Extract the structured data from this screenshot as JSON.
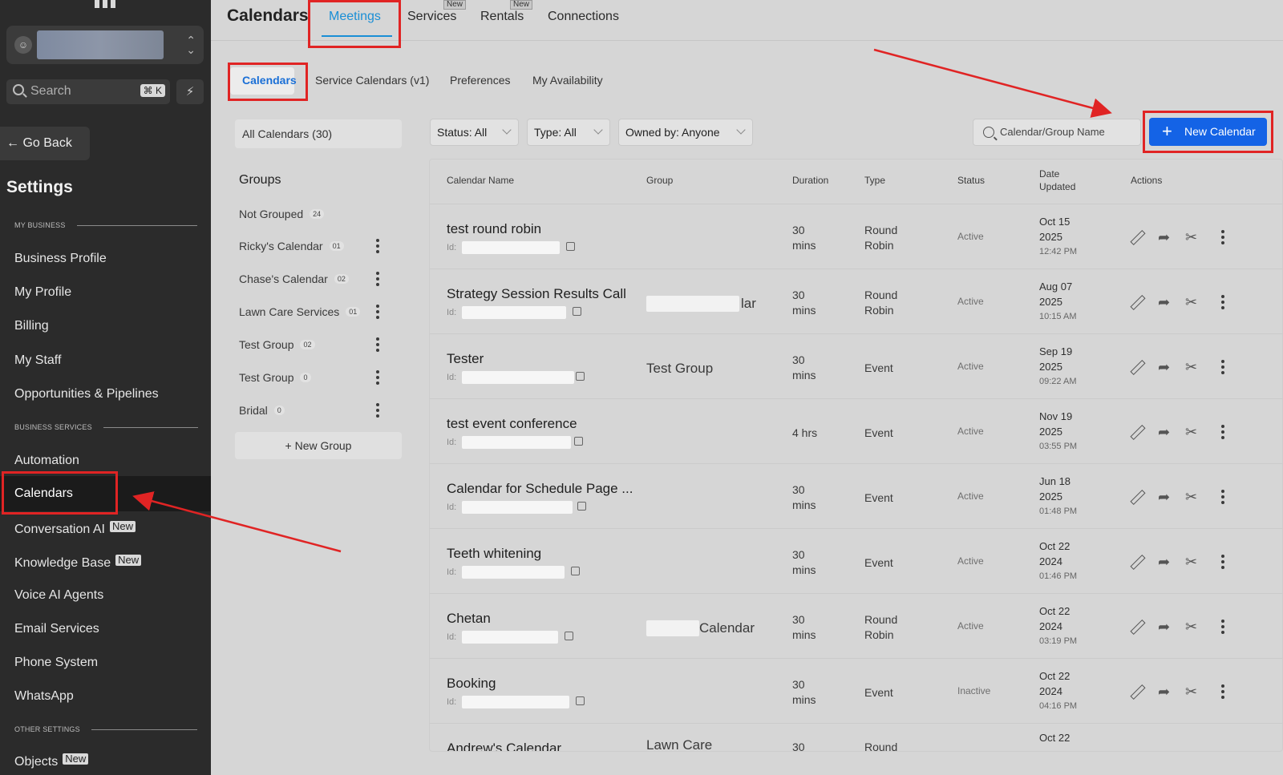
{
  "sidebar": {
    "search_label": "Search",
    "search_kbd": "⌘ K",
    "go_back": "Go Back",
    "settings_title": "Settings",
    "section_my_business": "MY BUSINESS",
    "section_business_services": "BUSINESS SERVICES",
    "section_other_settings": "OTHER SETTINGS",
    "items": {
      "business_profile": "Business Profile",
      "my_profile": "My Profile",
      "billing": "Billing",
      "my_staff": "My Staff",
      "opportunities": "Opportunities & Pipelines",
      "automation": "Automation",
      "calendars": "Calendars",
      "conversation_ai": "Conversation AI",
      "knowledge_base": "Knowledge Base",
      "voice_ai": "Voice AI Agents",
      "email_services": "Email Services",
      "phone_system": "Phone System",
      "whatsapp": "WhatsApp",
      "objects": "Objects"
    },
    "new_badge": "New"
  },
  "header": {
    "title": "Calendars",
    "tabs": {
      "meetings": "Meetings",
      "services": "Services",
      "rentals": "Rentals",
      "connections": "Connections"
    },
    "new_tag": "New"
  },
  "subtabs": {
    "calendars": "Calendars",
    "service_calendars": "Service Calendars (v1)",
    "preferences": "Preferences",
    "my_availability": "My Availability"
  },
  "groups_panel": {
    "all_calendars": "All Calendars (30)",
    "title": "Groups",
    "new_group": "New Group",
    "groups": [
      {
        "name": "Not Grouped",
        "count": "24"
      },
      {
        "name": "Ricky's Calendar",
        "count": "01"
      },
      {
        "name": "Chase's Calendar",
        "count": "02"
      },
      {
        "name": "Lawn Care Services",
        "count": "01"
      },
      {
        "name": "Test Group",
        "count": "02"
      },
      {
        "name": "Test Group",
        "count": "0"
      },
      {
        "name": "Bridal",
        "count": "0"
      }
    ]
  },
  "filters": {
    "status": "Status: All",
    "type": "Type: All",
    "owned_by": "Owned by: Anyone",
    "search_placeholder": "Calendar/Group Name",
    "new_calendar": "New Calendar"
  },
  "table": {
    "headers": {
      "name": "Calendar Name",
      "group": "Group",
      "duration": "Duration",
      "type": "Type",
      "status": "Status",
      "date_line1": "Date",
      "date_line2": "Updated",
      "actions": "Actions"
    },
    "id_label": "Id:",
    "rows": [
      {
        "name": "test round robin",
        "group": "",
        "dur1": "30",
        "dur2": "mins",
        "type1": "Round",
        "type2": "Robin",
        "status": "Active",
        "date1": "Oct 15",
        "date2": "2025",
        "time": "12:42 PM"
      },
      {
        "name": "Strategy Session Results Call",
        "group": "lar",
        "dur1": "30",
        "dur2": "mins",
        "type1": "Round",
        "type2": "Robin",
        "status": "Active",
        "date1": "Aug 07",
        "date2": "2025",
        "time": "10:15 AM"
      },
      {
        "name": "Tester",
        "group": "Test Group",
        "dur1": "30",
        "dur2": "mins",
        "type1": "Event",
        "type2": "",
        "status": "Active",
        "date1": "Sep 19",
        "date2": "2025",
        "time": "09:22 AM"
      },
      {
        "name": "test event conference",
        "group": "",
        "dur1": "4 hrs",
        "dur2": "",
        "type1": "Event",
        "type2": "",
        "status": "Active",
        "date1": "Nov 19",
        "date2": "2025",
        "time": "03:55 PM"
      },
      {
        "name": "Calendar for Schedule Page ...",
        "group": "",
        "dur1": "30",
        "dur2": "mins",
        "type1": "Event",
        "type2": "",
        "status": "Active",
        "date1": "Jun 18",
        "date2": "2025",
        "time": "01:48 PM"
      },
      {
        "name": "Teeth whitening",
        "group": "",
        "dur1": "30",
        "dur2": "mins",
        "type1": "Event",
        "type2": "",
        "status": "Active",
        "date1": "Oct 22",
        "date2": "2024",
        "time": "01:46 PM"
      },
      {
        "name": "Chetan",
        "group": "Calendar",
        "dur1": "30",
        "dur2": "mins",
        "type1": "Round",
        "type2": "Robin",
        "status": "Active",
        "date1": "Oct 22",
        "date2": "2024",
        "time": "03:19 PM"
      },
      {
        "name": "Booking",
        "group": "",
        "dur1": "30",
        "dur2": "mins",
        "type1": "Event",
        "type2": "",
        "status": "Inactive",
        "date1": "Oct 22",
        "date2": "2024",
        "time": "04:16 PM"
      },
      {
        "name": "Andrew's Calendar",
        "group": "Lawn Care",
        "dur1": "30",
        "dur2": "",
        "type1": "Round",
        "type2": "",
        "status": "",
        "date1": "Oct 22",
        "date2": "",
        "time": ""
      }
    ]
  },
  "colors": {
    "accent": "#1a8fd6",
    "primary_button": "#1463e6",
    "highlight_box": "#e02424",
    "sidebar_bg": "#2b2b2b"
  }
}
